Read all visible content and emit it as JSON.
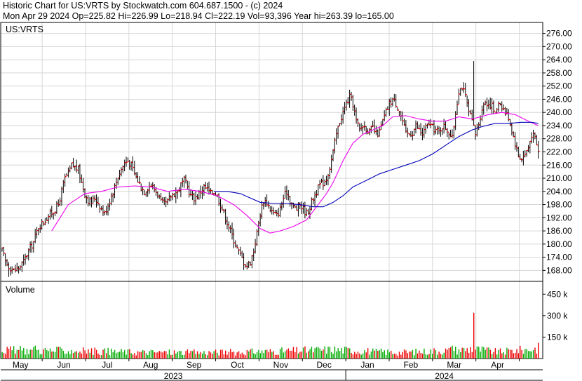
{
  "header": {
    "line1": "Historic Chart for US:VRTS by Stockwatch.com 604.687.1500 - (c) 2024",
    "line2": "Mon Apr 29 2024   Op=225.82  Hi=226.99  Lo=218.94  Cl=222.19  Vol=93,396  Year hi=263.39  lo=165.00"
  },
  "chart_data": [
    {
      "type": "bar",
      "style": "ohlc",
      "ticker_label": "US:VRTS",
      "y_ticks": [
        "276.00",
        "270.00",
        "264.00",
        "258.00",
        "252.00",
        "246.00",
        "240.00",
        "234.00",
        "228.00",
        "222.00",
        "216.00",
        "210.00",
        "204.00",
        "198.00",
        "192.00",
        "186.00",
        "180.00",
        "174.00",
        "168.00"
      ],
      "ylim": [
        163.0,
        281.0
      ],
      "grid": true,
      "x_ticks": [
        "May",
        "Jun",
        "Jul",
        "Aug",
        "Sep",
        "Oct",
        "Nov",
        "Dec",
        "Jan",
        "Feb",
        "Mar",
        "Apr"
      ],
      "years": [
        "2023",
        "2024"
      ],
      "year_hi": 263.39,
      "year_lo": 165.0,
      "last_bar": {
        "date": "2024-04-29",
        "open": 225.82,
        "high": 226.99,
        "low": 218.94,
        "close": 222.19
      },
      "price_anchors": [
        [
          0,
          177
        ],
        [
          2,
          172
        ],
        [
          4,
          170
        ],
        [
          7,
          168
        ],
        [
          10,
          169
        ],
        [
          13,
          172
        ],
        [
          16,
          177
        ],
        [
          19,
          181
        ],
        [
          22,
          188
        ],
        [
          25,
          190
        ],
        [
          28,
          193
        ],
        [
          31,
          195
        ],
        [
          34,
          198
        ],
        [
          36,
          204
        ],
        [
          38,
          210
        ],
        [
          40,
          212
        ],
        [
          42,
          216
        ],
        [
          44,
          215
        ],
        [
          46,
          214
        ],
        [
          48,
          208
        ],
        [
          50,
          203
        ],
        [
          52,
          200
        ],
        [
          54,
          199
        ],
        [
          56,
          201
        ],
        [
          58,
          199
        ],
        [
          60,
          196
        ],
        [
          62,
          194
        ],
        [
          64,
          198
        ],
        [
          66,
          202
        ],
        [
          68,
          206
        ],
        [
          70,
          211
        ],
        [
          72,
          214
        ],
        [
          74,
          217
        ],
        [
          76,
          218
        ],
        [
          78,
          216
        ],
        [
          80,
          212
        ],
        [
          82,
          209
        ],
        [
          84,
          206
        ],
        [
          86,
          204
        ],
        [
          88,
          206
        ],
        [
          90,
          207
        ],
        [
          92,
          205
        ],
        [
          94,
          203
        ],
        [
          96,
          199
        ],
        [
          98,
          198
        ],
        [
          100,
          199
        ],
        [
          102,
          202
        ],
        [
          104,
          203
        ],
        [
          106,
          204
        ],
        [
          108,
          207
        ],
        [
          110,
          209
        ],
        [
          112,
          206
        ],
        [
          114,
          202
        ],
        [
          116,
          201
        ],
        [
          118,
          202
        ],
        [
          120,
          204
        ],
        [
          122,
          206
        ],
        [
          124,
          205
        ],
        [
          126,
          203
        ],
        [
          128,
          204
        ],
        [
          130,
          202
        ],
        [
          132,
          198
        ],
        [
          134,
          194
        ],
        [
          136,
          190
        ],
        [
          138,
          186
        ],
        [
          140,
          182
        ],
        [
          142,
          178
        ],
        [
          144,
          175
        ],
        [
          146,
          172
        ],
        [
          148,
          170
        ],
        [
          150,
          172
        ],
        [
          152,
          177
        ],
        [
          154,
          185
        ],
        [
          156,
          194
        ],
        [
          158,
          200
        ],
        [
          160,
          199
        ],
        [
          162,
          196
        ],
        [
          164,
          194
        ],
        [
          166,
          193
        ],
        [
          168,
          196
        ],
        [
          170,
          201
        ],
        [
          172,
          204
        ],
        [
          174,
          200
        ],
        [
          176,
          197
        ],
        [
          178,
          196
        ],
        [
          180,
          198
        ],
        [
          182,
          196
        ],
        [
          184,
          194
        ],
        [
          186,
          197
        ],
        [
          188,
          201
        ],
        [
          190,
          204
        ],
        [
          192,
          207
        ],
        [
          194,
          208
        ],
        [
          196,
          210
        ],
        [
          198,
          215
        ],
        [
          200,
          222
        ],
        [
          202,
          230
        ],
        [
          204,
          236
        ],
        [
          206,
          240
        ],
        [
          208,
          244
        ],
        [
          210,
          247
        ],
        [
          212,
          244
        ],
        [
          214,
          236
        ],
        [
          216,
          232
        ],
        [
          218,
          234
        ],
        [
          220,
          233
        ],
        [
          222,
          231
        ],
        [
          224,
          233
        ],
        [
          226,
          230
        ],
        [
          228,
          231
        ],
        [
          230,
          236
        ],
        [
          232,
          240
        ],
        [
          234,
          244
        ],
        [
          236,
          246
        ],
        [
          238,
          244
        ],
        [
          240,
          241
        ],
        [
          242,
          236
        ],
        [
          244,
          230
        ],
        [
          246,
          230
        ],
        [
          248,
          231
        ],
        [
          250,
          234
        ],
        [
          252,
          232
        ],
        [
          254,
          230
        ],
        [
          256,
          233
        ],
        [
          258,
          235
        ],
        [
          260,
          233
        ],
        [
          262,
          232
        ],
        [
          264,
          231
        ],
        [
          266,
          234
        ],
        [
          268,
          233
        ],
        [
          270,
          231
        ],
        [
          272,
          228
        ],
        [
          274,
          240
        ],
        [
          276,
          250
        ],
        [
          278,
          252
        ],
        [
          280,
          247
        ],
        [
          282,
          240
        ],
        [
          284,
          236
        ],
        [
          286,
          230
        ],
        [
          288,
          235
        ],
        [
          290,
          242
        ],
        [
          292,
          245
        ],
        [
          294,
          244
        ],
        [
          296,
          243
        ],
        [
          298,
          239
        ],
        [
          300,
          245
        ],
        [
          302,
          243
        ],
        [
          304,
          240
        ],
        [
          306,
          238
        ],
        [
          308,
          232
        ],
        [
          310,
          226
        ],
        [
          312,
          220
        ],
        [
          314,
          219
        ],
        [
          316,
          221
        ],
        [
          318,
          224
        ],
        [
          320,
          230
        ],
        [
          322,
          228
        ],
        [
          324,
          222
        ]
      ],
      "ma_anchors": {
        "ma_fast": [
          [
            30,
            186
          ],
          [
            40,
            198
          ],
          [
            50,
            203
          ],
          [
            60,
            204
          ],
          [
            70,
            206
          ],
          [
            80,
            206.5
          ],
          [
            90,
            206
          ],
          [
            100,
            204
          ],
          [
            110,
            205
          ],
          [
            120,
            204
          ],
          [
            130,
            202
          ],
          [
            140,
            198
          ],
          [
            148,
            193
          ],
          [
            156,
            187
          ],
          [
            162,
            185
          ],
          [
            168,
            186
          ],
          [
            176,
            188
          ],
          [
            184,
            191
          ],
          [
            190,
            197
          ],
          [
            196,
            203
          ],
          [
            200,
            208
          ],
          [
            206,
            218
          ],
          [
            212,
            226
          ],
          [
            218,
            230
          ],
          [
            224,
            232
          ],
          [
            230,
            234
          ],
          [
            236,
            238
          ],
          [
            244,
            238.5
          ],
          [
            252,
            237
          ],
          [
            260,
            236
          ],
          [
            268,
            236
          ],
          [
            276,
            238
          ],
          [
            284,
            237
          ],
          [
            294,
            239
          ],
          [
            302,
            240
          ],
          [
            310,
            239
          ],
          [
            318,
            236
          ],
          [
            324,
            234
          ]
        ],
        "ma_slow": [
          [
            128,
            204
          ],
          [
            136,
            204
          ],
          [
            144,
            203
          ],
          [
            150,
            201
          ],
          [
            156,
            199
          ],
          [
            164,
            198.5
          ],
          [
            172,
            198.5
          ],
          [
            180,
            198
          ],
          [
            188,
            197
          ],
          [
            194,
            197
          ],
          [
            200,
            199
          ],
          [
            206,
            202
          ],
          [
            212,
            206
          ],
          [
            220,
            209
          ],
          [
            228,
            212
          ],
          [
            236,
            214
          ],
          [
            244,
            216
          ],
          [
            252,
            218
          ],
          [
            260,
            221
          ],
          [
            268,
            225
          ],
          [
            276,
            229
          ],
          [
            284,
            232
          ],
          [
            290,
            233.5
          ],
          [
            298,
            235
          ],
          [
            306,
            235
          ],
          [
            314,
            235.5
          ],
          [
            320,
            235.5
          ],
          [
            324,
            235
          ]
        ]
      }
    },
    {
      "type": "bar",
      "label": "Volume",
      "y_ticks": [
        "450 k",
        "300 k",
        "150 k"
      ],
      "ylim": [
        0,
        520000
      ],
      "volume_anchors": [
        [
          0,
          62000
        ],
        [
          40,
          58000
        ],
        [
          80,
          47000
        ],
        [
          120,
          44000
        ],
        [
          160,
          51000
        ],
        [
          200,
          66000
        ],
        [
          240,
          44000
        ],
        [
          270,
          60000
        ],
        [
          285,
          70000
        ],
        [
          300,
          48000
        ],
        [
          325,
          75000
        ]
      ],
      "spikes": [
        [
          20,
          90000
        ],
        [
          86,
          55000
        ],
        [
          157,
          56000
        ],
        [
          225,
          55000
        ],
        [
          272,
          90000
        ],
        [
          283,
          80000
        ],
        [
          285,
          320000
        ],
        [
          310,
          40000
        ],
        [
          324,
          110000
        ]
      ],
      "colors": {
        "up": "#00aa00",
        "down": "#ee0000"
      }
    }
  ],
  "colors": {
    "price_bar": "#000000",
    "close_tick": "#ee0000",
    "ma_fast": "#ee00ee",
    "ma_slow": "#0000bb",
    "grid": "#d6d6d6",
    "axis": "#000000"
  }
}
